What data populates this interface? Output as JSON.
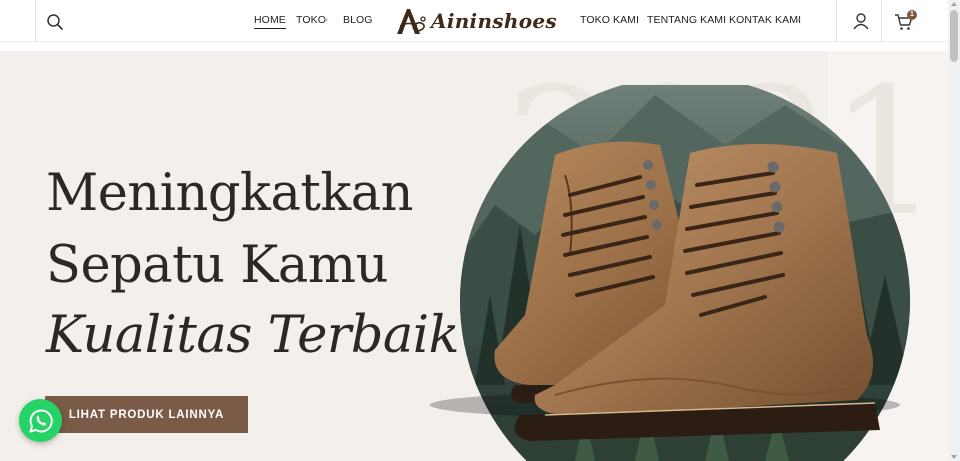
{
  "header": {
    "brand": "Aininshoes",
    "nav_left": [
      {
        "label": "HOME",
        "active": true
      },
      {
        "label": "TOKO",
        "has_dropdown": true
      },
      {
        "label": "BLOG"
      }
    ],
    "nav_right": [
      {
        "label": "TOKO KAMI"
      },
      {
        "label": "TENTANG KAMI"
      },
      {
        "label": "KONTAK KAMI",
        "has_dropdown": true
      }
    ],
    "icons": [
      "search-icon",
      "user-icon",
      "cart-icon"
    ],
    "cart_count": "1"
  },
  "hero": {
    "background_year": "2021",
    "headline_line1": "Meningkatkan",
    "headline_line2": "Sepatu Kamu",
    "headline_line3": "Kualitas Terbaik",
    "cta_label": "LIHAT PRODUK LAINNYA"
  },
  "floating": {
    "icon": "whatsapp-icon"
  },
  "colors": {
    "accent_brown": "#7a5b48",
    "hero_bg": "#f3efea",
    "whatsapp_green": "#25d366",
    "text_dark": "#2b2827"
  }
}
